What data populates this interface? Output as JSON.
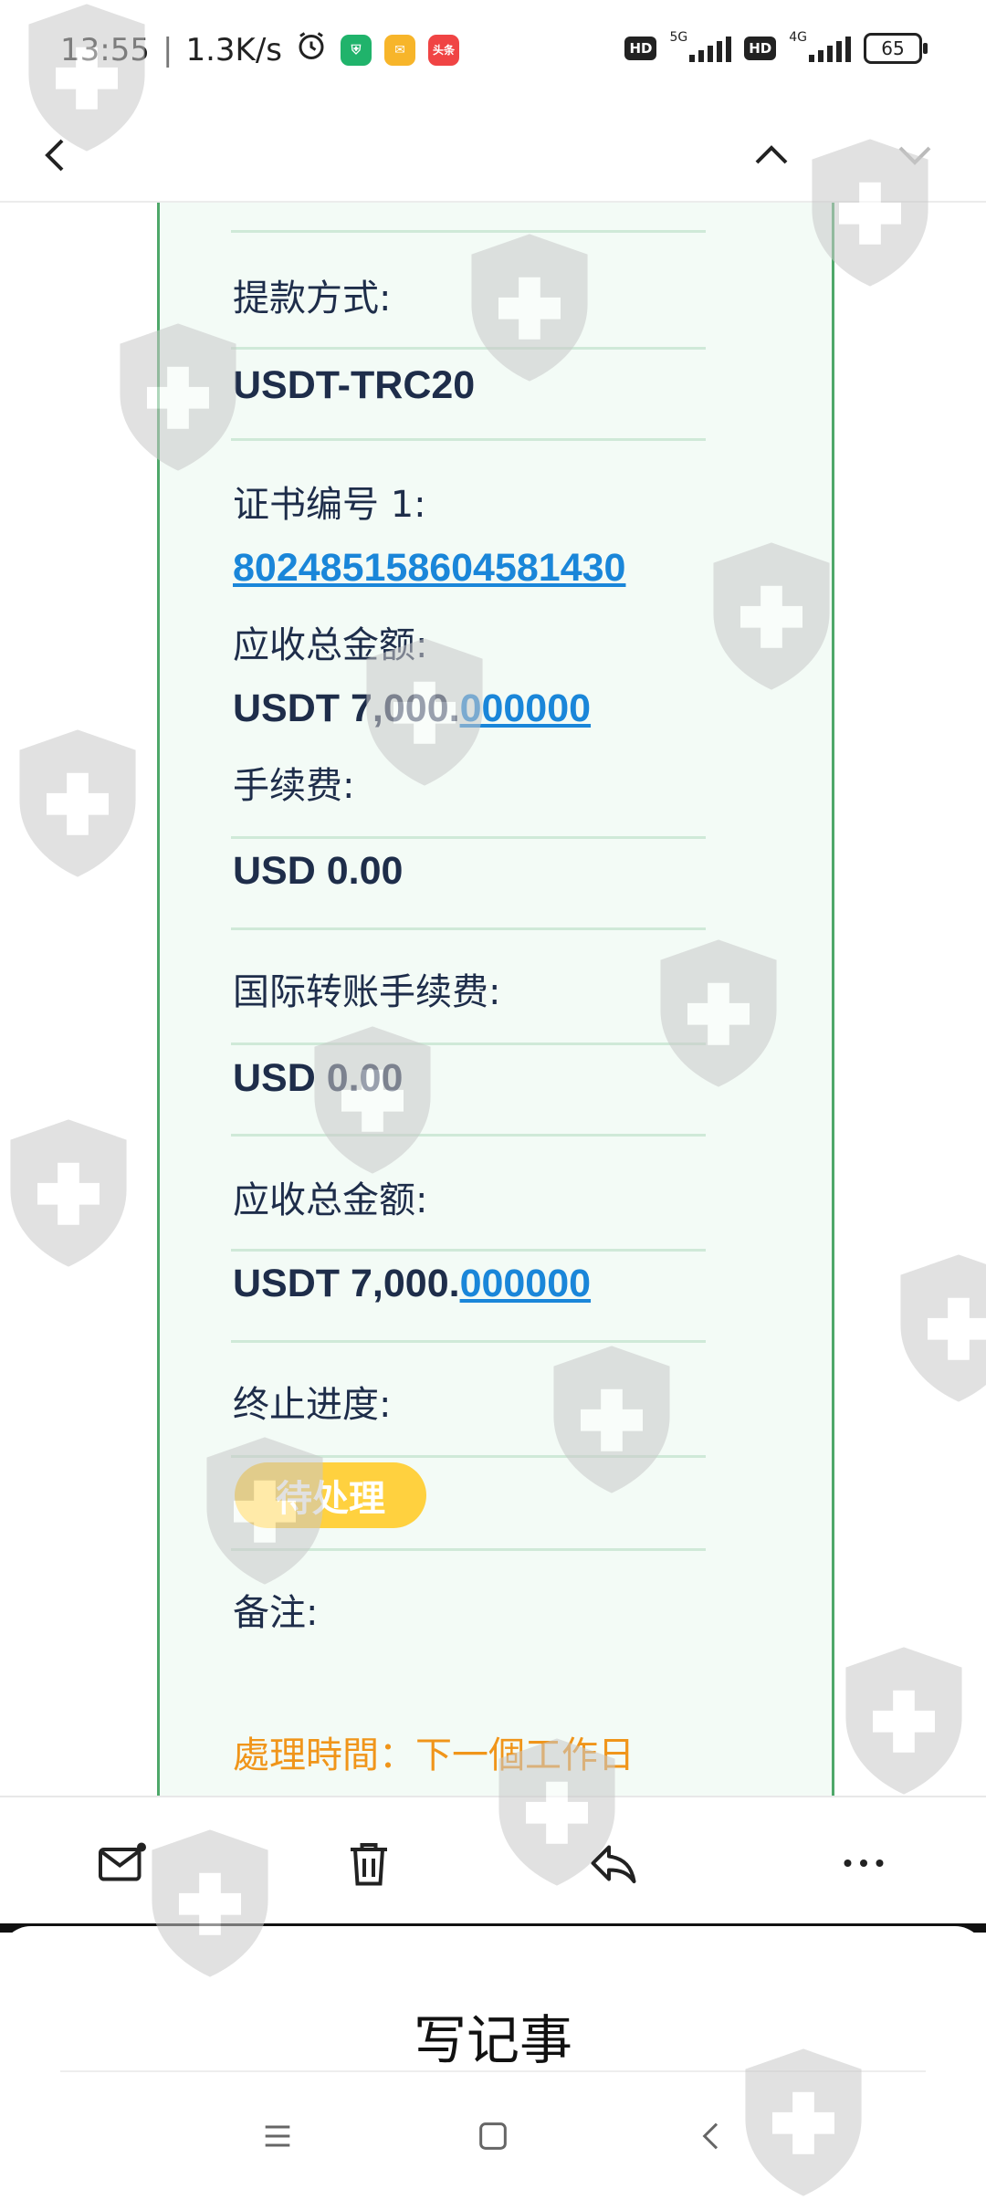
{
  "status_bar": {
    "time": "13:55",
    "speed": "1.3K/s",
    "network_1": "5G",
    "network_2": "4G",
    "hd_label": "HD",
    "battery": "65",
    "app_badge_text": "头条"
  },
  "nav": {
    "back_icon": "chevron-left-icon",
    "prev_icon": "chevron-up-icon",
    "next_icon": "chevron-down-icon"
  },
  "details": {
    "withdraw_method_label": "提款方式:",
    "withdraw_method_value": "USDT-TRC20",
    "certificate_label": "证书编号 1:",
    "certificate_value": "802485158604581430",
    "total_label_1": "应收总金额:",
    "total_value_1_prefix": "USDT 7,000.",
    "total_value_1_link": "000000",
    "fee_label": "手续费:",
    "fee_value": "USD 0.00",
    "intl_fee_label": "国际转账手续费:",
    "intl_fee_value": "USD 0.00",
    "total_label_2": "应收总金额:",
    "total_value_2_prefix": "USDT 7,000.",
    "total_value_2_link": "000000",
    "progress_label": "终止进度:",
    "progress_status": "待处理",
    "remark_label": "备注:",
    "processing_time": "處理時間：下一個工作日"
  },
  "toolbar": {
    "mark_unread_icon": "mail-dot-icon",
    "delete_icon": "trash-icon",
    "reply_icon": "reply-icon",
    "more_icon": "more-icon"
  },
  "sheet": {
    "title": "写记事"
  },
  "colors": {
    "card_bg": "#f3fbf6",
    "card_border": "#4fa86a",
    "text_dark": "#1e2d4a",
    "link_blue": "#1a86d9",
    "badge_yellow": "#ffd13f",
    "orange_text": "#f0951a"
  }
}
